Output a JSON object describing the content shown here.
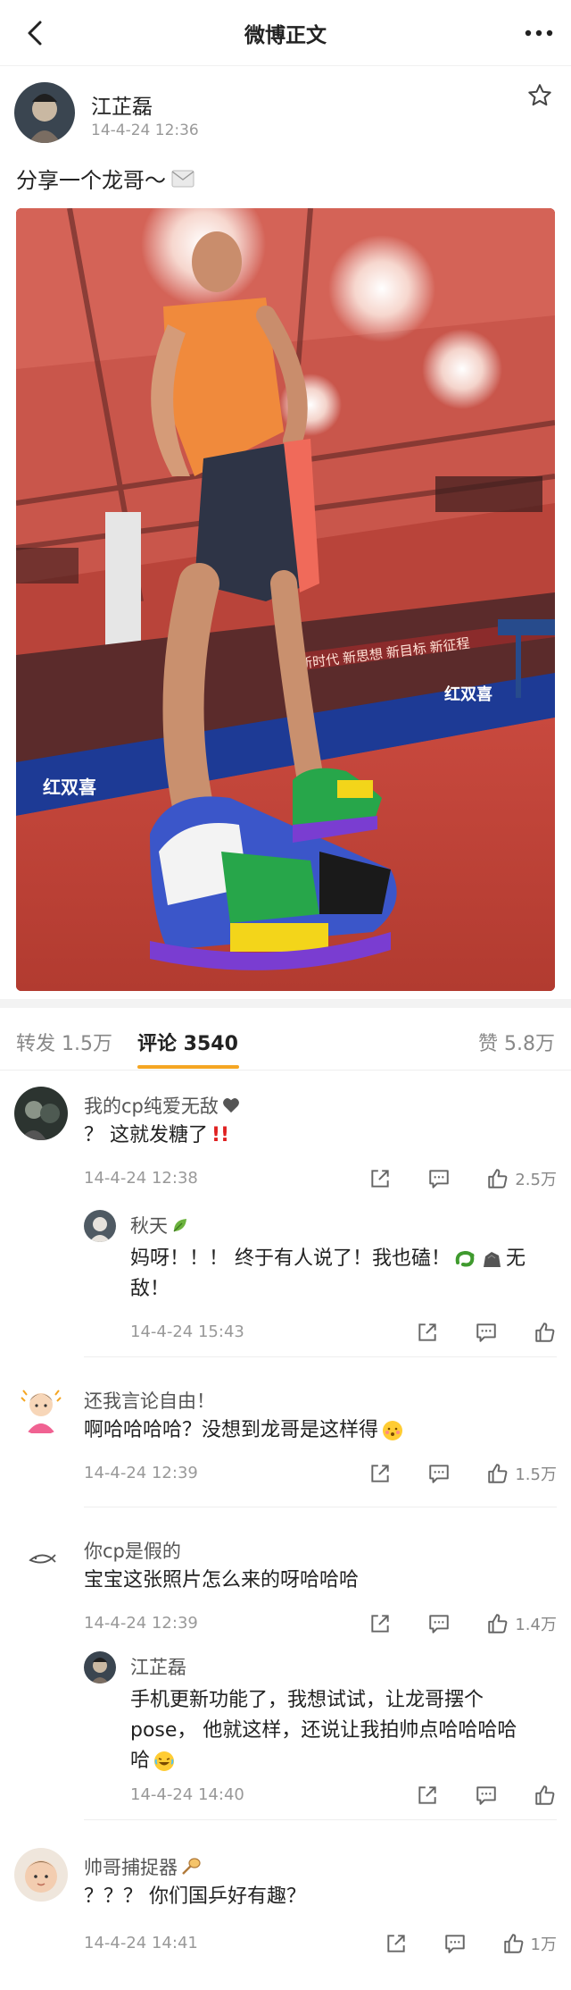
{
  "topbar": {
    "title": "微博正文"
  },
  "post": {
    "author_name": "江芷磊",
    "time": "14-4-24 12:36",
    "text": "分享一个龙哥～"
  },
  "tabs": [
    {
      "label": "转发 1.5万"
    },
    {
      "label": "评论 3540"
    },
    {
      "label": "赞 5.8万"
    }
  ],
  "comments": [
    {
      "name": "我的cp纯爱无敌",
      "text": "？ 这就发糖了",
      "time": "14-4-24 12:38",
      "likes": "2.5万",
      "reply": {
        "name": "秋天",
        "text_line1": "妈呀！！！ 终于有人说了！我也磕！",
        "text_line1_tail": "无",
        "text_line2": "敌！",
        "time": "14-4-24 15:43"
      }
    },
    {
      "name": "还我言论自由！",
      "text": "啊哈哈哈哈？没想到龙哥是这样得",
      "time": "14-4-24 12:39",
      "likes": "1.5万"
    },
    {
      "name": "你cp是假的",
      "text": "宝宝这张照片怎么来的呀哈哈哈",
      "time": "14-4-24 12:39",
      "likes": "1.4万",
      "reply": {
        "name": "江芷磊",
        "text_line1": "手机更新功能了，我想试试，让龙哥摆个",
        "text_line2": "pose， 他就这样，还说让我拍帅点哈哈哈哈",
        "text_line3": "哈",
        "time": "14-4-24 14:40"
      }
    },
    {
      "name": "帅哥捕捉器",
      "text": "？？？ 你们国乒好有趣？",
      "time": "14-4-24 14:41",
      "likes": "1万"
    }
  ],
  "photo": {
    "banner_left": "红双喜",
    "banner_mid": "新时代 新思想 新目标 新征程",
    "banner_right": "红双喜"
  },
  "icons": {
    "back": "chevron-left-icon",
    "more": "ellipsis-icon",
    "favorite": "star-icon",
    "share": "share-icon",
    "comment": "comment-icon",
    "like": "thumbs-up-icon"
  },
  "colors": {
    "accent": "#f5a623",
    "text_primary": "#222222",
    "text_secondary": "#999999"
  }
}
